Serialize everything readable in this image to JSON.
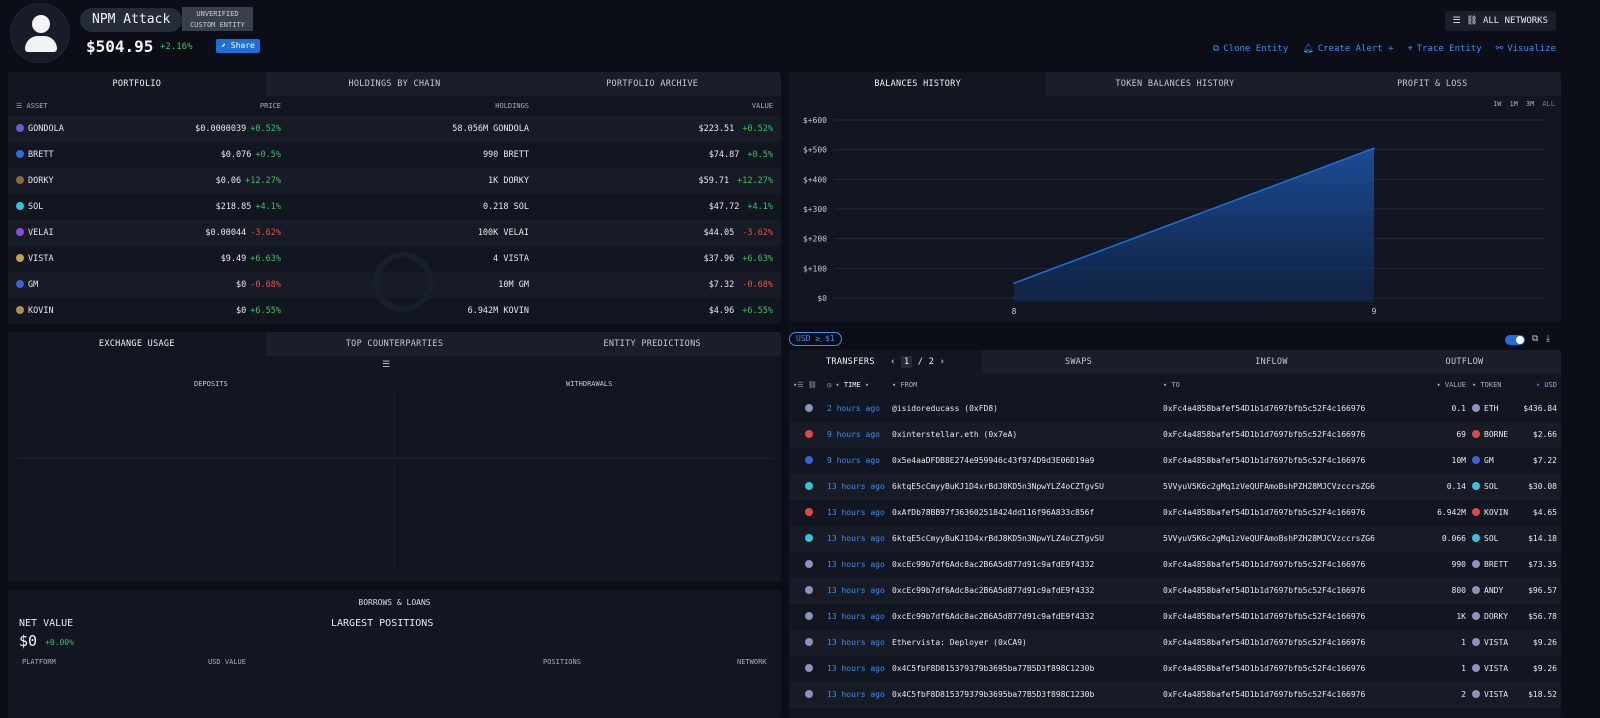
{
  "header": {
    "entity_name": "NPM Attack",
    "badge_line1": "UNVERIFIED",
    "badge_line2": "CUSTOM ENTITY",
    "net_worth": "$504.95",
    "net_change": "+2.16%",
    "share_label": "Share",
    "networks_label": "ALL NETWORKS",
    "actions": [
      {
        "label": "Clone Entity",
        "icon": "clone-icon"
      },
      {
        "label": "Create Alert +",
        "icon": "bell-icon"
      },
      {
        "label": "Trace Entity",
        "icon": "trace-icon"
      },
      {
        "label": "Visualize",
        "icon": "graph-icon"
      }
    ]
  },
  "portfolio": {
    "tabs": [
      "PORTFOLIO",
      "HOLDINGS BY CHAIN",
      "PORTFOLIO ARCHIVE"
    ],
    "columns": [
      "ASSET",
      "PRICE",
      "HOLDINGS",
      "VALUE"
    ],
    "rows": [
      {
        "asset": "GONDOLA",
        "price": "$0.0000039",
        "price_change": "+0.52%",
        "holdings": "58.056M GONDOLA",
        "value": "$223.51",
        "value_change": "+0.52%",
        "color": "#6b5bd6"
      },
      {
        "asset": "BRETT",
        "price": "$0.076",
        "price_change": "+0.5%",
        "holdings": "990 BRETT",
        "value": "$74.87",
        "value_change": "+0.5%",
        "color": "#2a6fe0"
      },
      {
        "asset": "DORKY",
        "price": "$0.06",
        "price_change": "+12.27%",
        "holdings": "1K DORKY",
        "value": "$59.71",
        "value_change": "+12.27%",
        "color": "#8a6a3a"
      },
      {
        "asset": "SOL",
        "price": "$218.85",
        "price_change": "+4.1%",
        "holdings": "0.218 SOL",
        "value": "$47.72",
        "value_change": "+4.1%",
        "color": "#34c3d8"
      },
      {
        "asset": "VELAI",
        "price": "$0.00044",
        "price_change": "-3.62%",
        "holdings": "100K VELAI",
        "value": "$44.05",
        "value_change": "-3.62%",
        "color": "#8a4ce0"
      },
      {
        "asset": "VISTA",
        "price": "$9.49",
        "price_change": "+6.63%",
        "holdings": "4 VISTA",
        "value": "$37.96",
        "value_change": "+6.63%",
        "color": "#c9a24a"
      },
      {
        "asset": "GM",
        "price": "$0",
        "price_change": "-0.68%",
        "holdings": "10M GM",
        "value": "$7.32",
        "value_change": "-0.68%",
        "color": "#3a62d8"
      },
      {
        "asset": "KOVIN",
        "price": "$0",
        "price_change": "+6.55%",
        "holdings": "6.942M KOVIN",
        "value": "$4.96",
        "value_change": "+6.55%",
        "color": "#b08a50"
      }
    ]
  },
  "balances": {
    "tabs": [
      "BALANCES HISTORY",
      "TOKEN BALANCES HISTORY",
      "PROFIT & LOSS"
    ],
    "ranges": [
      "1W",
      "1M",
      "3M",
      "ALL"
    ],
    "active_range": "ALL"
  },
  "chart_data": {
    "type": "area",
    "x": [
      "8",
      "9"
    ],
    "values": [
      50,
      505
    ],
    "title": "",
    "xlabel": "",
    "ylabel": "",
    "ylim": [
      0,
      600
    ],
    "y_ticks": [
      "$0",
      "$+100",
      "$+200",
      "$+300",
      "$+400",
      "$+500",
      "$+600"
    ],
    "grid": true,
    "color": "#1f6fd8"
  },
  "exchange": {
    "tabs": [
      "EXCHANGE USAGE",
      "TOP COUNTERPARTIES",
      "ENTITY PREDICTIONS"
    ],
    "deposits_label": "DEPOSITS",
    "withdrawals_label": "WITHDRAWALS"
  },
  "borrows": {
    "title": "BORROWS & LOANS",
    "net_value_label": "NET VALUE",
    "net_value": "$0",
    "net_change": "+0.00%",
    "largest_positions_label": "LARGEST POSITIONS",
    "columns": [
      "PLATFORM",
      "USD VALUE",
      "POSITIONS",
      "NETWORK"
    ]
  },
  "transfers": {
    "filter_label": "USD ≥ $1",
    "tabs": [
      "TRANSFERS",
      "SWAPS",
      "INFLOW",
      "OUTFLOW"
    ],
    "page_current": "1",
    "page_total": "2",
    "columns": [
      "TIME",
      "FROM",
      "TO",
      "VALUE",
      "TOKEN",
      "USD"
    ],
    "rows": [
      {
        "time": "2 hours ago",
        "from": "@isidoreducass (0xFD8)",
        "to": "0xFc4a4858bafef54D1b1d7697bfb5c52F4c166976",
        "value": "0.1",
        "token": "ETH",
        "usd": "$436.84",
        "color": "#8a93b8"
      },
      {
        "time": "9 hours ago",
        "from": "0xinterstellar.eth (0x7eA)",
        "to": "0xFc4a4858bafef54D1b1d7697bfb5c52F4c166976",
        "value": "69",
        "token": "BORNE",
        "usd": "$2.66",
        "color": "#e04848"
      },
      {
        "time": "9 hours ago",
        "from": "0x5e4aaDFDB8E274e959946c43f974D9d3E06D19a9",
        "to": "0xFc4a4858bafef54D1b1d7697bfb5c52F4c166976",
        "value": "10M",
        "token": "GM",
        "usd": "$7.22",
        "color": "#3a62d8"
      },
      {
        "time": "13 hours ago",
        "from": "6ktqE5cCmyyBuKJ1D4xrBdJ8KD5n3NpwYLZ4oCZTgvSU",
        "to": "5VVyuV5K6c2gMq1zVeQUFAmoBshPZH28MJCVzccrsZG6",
        "value": "0.14",
        "token": "SOL",
        "usd": "$30.08",
        "color": "#34c3d8"
      },
      {
        "time": "13 hours ago",
        "from": "0xAfDb78BB97f363602518424dd116f96A833c856f",
        "to": "0xFc4a4858bafef54D1b1d7697bfb5c52F4c166976",
        "value": "6.942M",
        "token": "KOVIN",
        "usd": "$4.65",
        "color": "#e04848"
      },
      {
        "time": "13 hours ago",
        "from": "6ktqE5cCmyyBuKJ1D4xrBdJ8KD5n3NpwYLZ4oCZTgvSU",
        "to": "5VVyuV5K6c2gMq1zVeQUFAmoBshPZH28MJCVzccrsZG6",
        "value": "0.066",
        "token": "SOL",
        "usd": "$14.18",
        "color": "#34c3d8"
      },
      {
        "time": "13 hours ago",
        "from": "0xcEc99b7df6Adc8ac2B6A5d877d91c9afdE9f4332",
        "to": "0xFc4a4858bafef54D1b1d7697bfb5c52F4c166976",
        "value": "990",
        "token": "BRETT",
        "usd": "$73.35",
        "color": "#8a93b8"
      },
      {
        "time": "13 hours ago",
        "from": "0xcEc99b7df6Adc8ac2B6A5d877d91c9afdE9f4332",
        "to": "0xFc4a4858bafef54D1b1d7697bfb5c52F4c166976",
        "value": "800",
        "token": "ANDY",
        "usd": "$96.57",
        "color": "#8a93b8"
      },
      {
        "time": "13 hours ago",
        "from": "0xcEc99b7df6Adc8ac2B6A5d877d91c9afdE9f4332",
        "to": "0xFc4a4858bafef54D1b1d7697bfb5c52F4c166976",
        "value": "1K",
        "token": "DORKY",
        "usd": "$56.78",
        "color": "#8a93b8"
      },
      {
        "time": "13 hours ago",
        "from": "Ethervista: Deployer (0xCA9)",
        "to": "0xFc4a4858bafef54D1b1d7697bfb5c52F4c166976",
        "value": "1",
        "token": "VISTA",
        "usd": "$9.26",
        "color": "#8a93b8"
      },
      {
        "time": "13 hours ago",
        "from": "0x4C5fbF8D815379379b3695ba77B5D3f898C1230b",
        "to": "0xFc4a4858bafef54D1b1d7697bfb5c52F4c166976",
        "value": "1",
        "token": "VISTA",
        "usd": "$9.26",
        "color": "#8a93b8"
      },
      {
        "time": "13 hours ago",
        "from": "0x4C5fbF8D815379379b3695ba77B5D3f898C1230b",
        "to": "0xFc4a4858bafef54D1b1d7697bfb5c52F4c166976",
        "value": "2",
        "token": "VISTA",
        "usd": "$18.52",
        "color": "#8a93b8"
      }
    ]
  }
}
